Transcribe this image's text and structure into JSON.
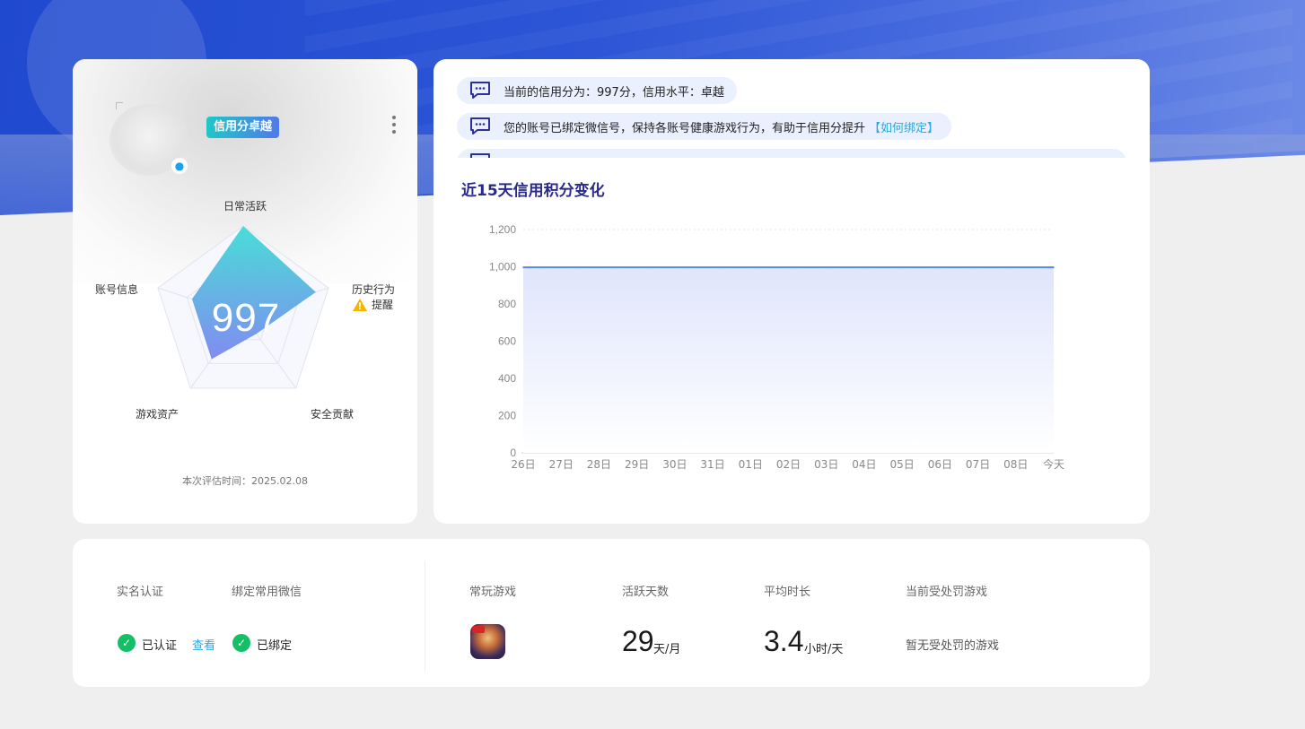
{
  "left_card": {
    "badge": "信用分卓越",
    "score": "997",
    "radar_labels": {
      "daily_active": "日常活跃",
      "history": "历史行为",
      "security": "安全贡献",
      "assets": "游戏资产",
      "account": "账号信息"
    },
    "history_warning": "提醒",
    "radar_values": {
      "daily_active": 1.0,
      "history": 0.85,
      "security": 0.25,
      "assets": 0.6,
      "account": 0.6
    },
    "eval_time": "本次评估时间：2025.02.08"
  },
  "notices": {
    "items": [
      {
        "text": "当前的信用分为：997分，信用水平：卓越",
        "link": ""
      },
      {
        "text": "您的账号已绑定微信号，保持各账号健康游戏行为，有助于信用分提升",
        "link": "【如何绑定】"
      }
    ]
  },
  "chart_title": "近15天信用积分变化",
  "chart_data": {
    "type": "area",
    "title": "近15天信用积分变化",
    "categories": [
      "26日",
      "27日",
      "28日",
      "29日",
      "30日",
      "31日",
      "01日",
      "02日",
      "03日",
      "04日",
      "05日",
      "06日",
      "07日",
      "08日",
      "今天"
    ],
    "values": [
      997,
      997,
      997,
      997,
      997,
      997,
      997,
      997,
      997,
      997,
      997,
      997,
      997,
      997,
      997
    ],
    "ylim": [
      0,
      1200
    ],
    "yticks": [
      "0",
      "200",
      "400",
      "600",
      "800",
      "1,000",
      "1,200"
    ],
    "grid": true,
    "colors": {
      "line": "#5b8be0",
      "fill": "#e2e8fb"
    }
  },
  "bottom": {
    "realname_label": "实名认证",
    "realname_value": "已认证",
    "realname_link": "查看",
    "wechat_label": "绑定常用微信",
    "wechat_value": "已绑定",
    "games_label": "常玩游戏",
    "active_days_label": "活跃天数",
    "active_days_value": "29",
    "active_days_unit": "天/月",
    "avg_time_label": "平均时长",
    "avg_time_value": "3.4",
    "avg_time_unit": "小时/天",
    "punish_label": "当前受处罚游戏",
    "punish_value": "暂无受处罚的游戏"
  },
  "colors": {
    "accent": "#2a4fd0",
    "success": "#14c066",
    "link": "#2ea7e0"
  }
}
